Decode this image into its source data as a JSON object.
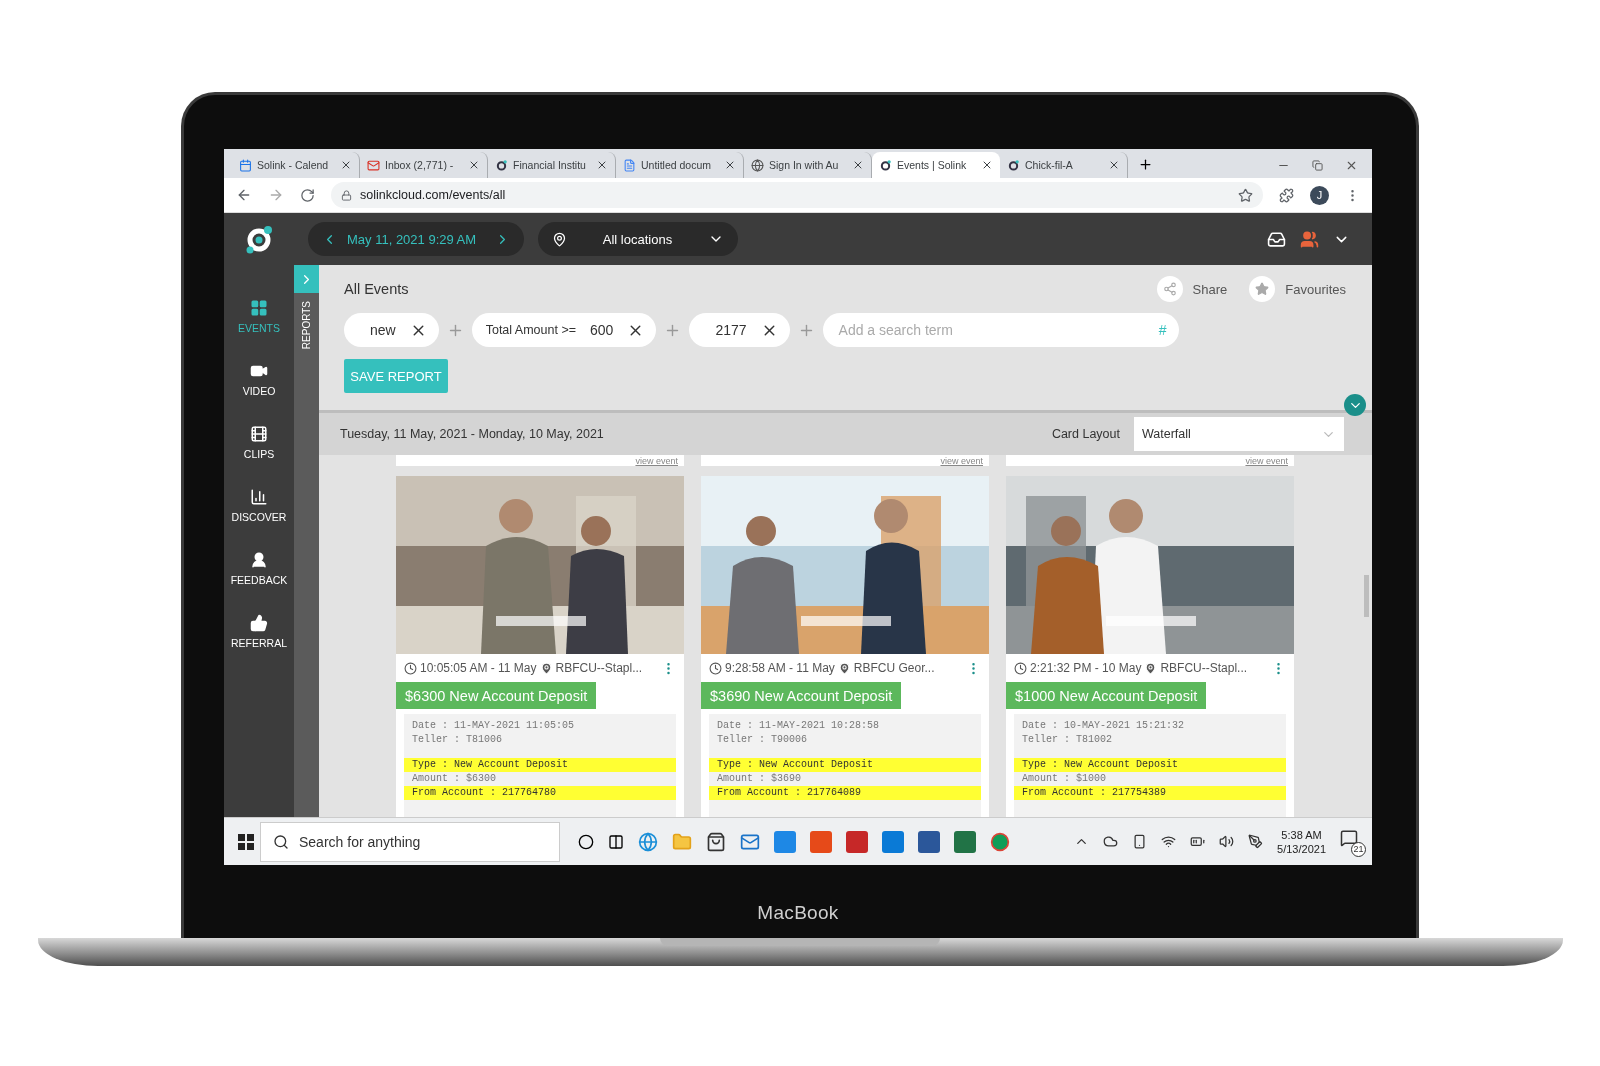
{
  "browser": {
    "tabs": [
      {
        "title": "Solink - Calend",
        "selected": false
      },
      {
        "title": "Inbox (2,771) -",
        "selected": false
      },
      {
        "title": "Financial Institu",
        "selected": false
      },
      {
        "title": "Untitled docum",
        "selected": false
      },
      {
        "title": "Sign In with Au",
        "selected": false
      },
      {
        "title": "Events | Solink",
        "selected": true
      },
      {
        "title": "Chick-fil-A",
        "selected": false
      }
    ],
    "url": "solinkcloud.com/events/all",
    "profile_initial": "J"
  },
  "app_header": {
    "date": "May 11, 2021 9:29 AM",
    "location": "All locations"
  },
  "sidebar": {
    "items": [
      {
        "label": "EVENTS",
        "selected": true
      },
      {
        "label": "VIDEO",
        "selected": false
      },
      {
        "label": "CLIPS",
        "selected": false
      },
      {
        "label": "DISCOVER",
        "selected": false
      },
      {
        "label": "FEEDBACK",
        "selected": false
      },
      {
        "label": "REFERRAL",
        "selected": false
      }
    ],
    "reports_tab": "REPORTS"
  },
  "page": {
    "title": "All Events",
    "share": "Share",
    "favourites": "Favourites",
    "filters": [
      {
        "value": "new"
      },
      {
        "field": "Total Amount >=",
        "value": "600"
      },
      {
        "value": "2177"
      }
    ],
    "search_placeholder": "Add a search term",
    "hash": "#",
    "save_button": "SAVE REPORT",
    "date_range": "Tuesday, 11 May, 2021 - Monday, 10 May, 2021",
    "card_layout_label": "Card Layout",
    "card_layout": "Waterfall"
  },
  "cards": [
    {
      "link": "view event",
      "time": "10:05:05 AM - 11 May",
      "location": "RBFCU--Stapl...",
      "title": "$6300 New Account Deposit",
      "details": [
        [
          {
            "text": "Date : 11-MAY-2021 11:05:05",
            "highlight": false
          },
          {
            "text": "Teller : T81006",
            "highlight": false
          }
        ],
        [
          {
            "text": "Type : New Account Deposit",
            "highlight": true
          },
          {
            "text": "Amount : $6300",
            "highlight": false
          },
          {
            "text": "From Account : 217764780",
            "highlight": true
          }
        ]
      ]
    },
    {
      "link": "view event",
      "time": "9:28:58 AM - 11 May",
      "location": "RBFCU Geor...",
      "title": "$3690 New Account Deposit",
      "details": [
        [
          {
            "text": "Date : 11-MAY-2021 10:28:58",
            "highlight": false
          },
          {
            "text": "Teller : T90006",
            "highlight": false
          }
        ],
        [
          {
            "text": "Type : New Account Deposit",
            "highlight": true
          },
          {
            "text": "Amount : $3690",
            "highlight": false
          },
          {
            "text": "From Account : 217764089",
            "highlight": true
          }
        ]
      ]
    },
    {
      "link": "view event",
      "time": "2:21:32 PM - 10 May",
      "location": "RBFCU--Stapl...",
      "title": "$1000 New Account Deposit",
      "details": [
        [
          {
            "text": "Date : 10-MAY-2021 15:21:32",
            "highlight": false
          },
          {
            "text": "Teller : T81002",
            "highlight": false
          }
        ],
        [
          {
            "text": "Type : New Account Deposit",
            "highlight": true
          },
          {
            "text": "Amount : $1000",
            "highlight": false
          },
          {
            "text": "From Account : 217754389",
            "highlight": true
          }
        ]
      ]
    }
  ],
  "taskbar": {
    "search_placeholder": "Search for anything",
    "time": "5:38 AM",
    "date": "5/13/2021",
    "notifications": "21"
  },
  "device_label": "MacBook"
}
